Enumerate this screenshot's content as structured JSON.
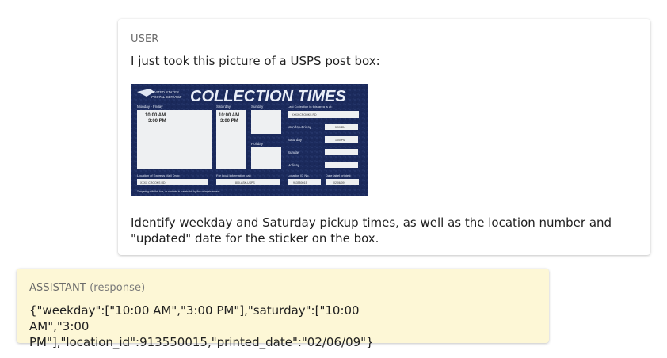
{
  "conversation": {
    "user": {
      "role_label": "USER",
      "intro": "I just took this picture of a USPS post box:",
      "question": "Identify weekday and Saturday pickup times, as well as the location number and \"updated\" date for the sticker on the box.",
      "image": {
        "logo_text_line1": "UNITED STATES",
        "logo_text_line2": "POSTAL SERVICE",
        "title": "COLLECTION TIMES",
        "col_weekday_header": "Monday - Friday",
        "col_saturday_header": "Saturday",
        "col_sunday_header": "Sunday",
        "holiday_label": "Holiday",
        "weekday_times": [
          "10:00 AM",
          "3:00 PM"
        ],
        "saturday_times": [
          "10:00 AM",
          "3:00 PM"
        ],
        "last_collection_header": "Last Collection in this area is at:",
        "last_collection_address": "XXXX CROOKS RD",
        "rows": [
          "Monday-Friday",
          "Saturday",
          "Sunday",
          "Holiday"
        ],
        "row_values": [
          "5:00 PM",
          "1:00 PM",
          "",
          ""
        ],
        "express_label": "Location of Express Mail Drop:",
        "express_value": "XXXX CROOKS RD",
        "local_info_label": "For local information call:",
        "local_info_value": "800-ASK-USPS",
        "location_id_label": "Location ID No.",
        "location_id_value": "913550015",
        "date_label": "Date label printed:",
        "date_value": "02/06/09",
        "footer_text": "Tampering with this box, or contents is punishable by fine or imprisonment."
      }
    },
    "assistant": {
      "role_label": "ASSISTANT",
      "role_suffix": "(response)",
      "response_text": "{\"weekday\":[\"10:00 AM\",\"3:00 PM\"],\"saturday\":[\"10:00 AM\",\"3:00 PM\"],\"location_id\":913550015,\"printed_date\":\"02/06/09\"}"
    }
  },
  "colors": {
    "assistant_bg": "#fdf7d6",
    "sticker_blue": "#1b2a5c",
    "sticker_panel": "#eef0f2"
  }
}
